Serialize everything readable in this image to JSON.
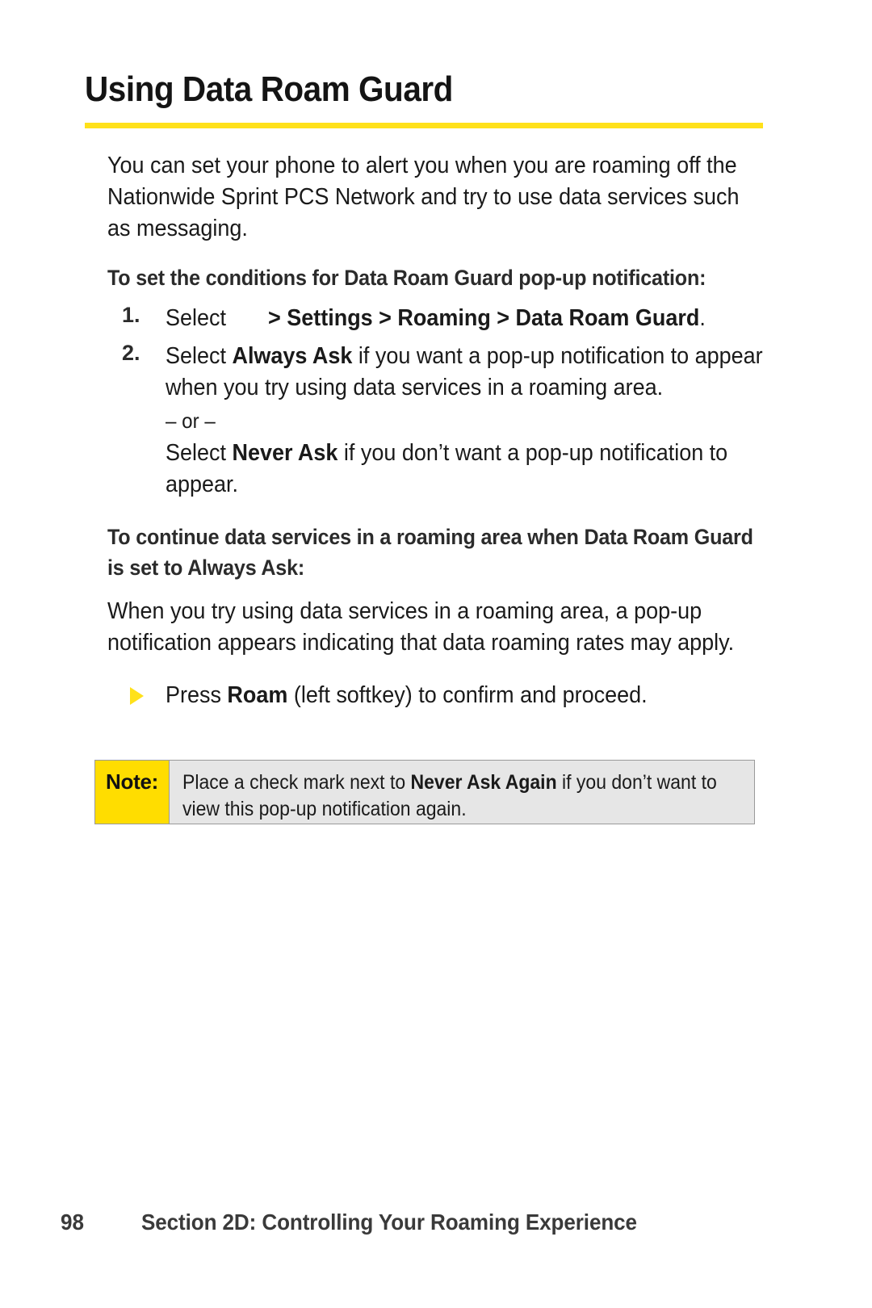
{
  "document": {
    "title": "Using Data Roam Guard",
    "accent_color": "#FFE11A",
    "note_label_color": "#FFDD00",
    "note_body_color": "#E6E6E6"
  },
  "intro": {
    "paragraph": "You can set your phone to alert you when you are roaming off the Nationwide Sprint PCS Network and try to use data services such as messaging."
  },
  "section_one": {
    "heading": "To set the conditions for Data Roam Guard pop-up notification:",
    "steps": [
      {
        "number": "1.",
        "lead": "Select",
        "menu_path": "> Settings > Roaming > Data Roam Guard",
        "trailing": "."
      },
      {
        "number": "2.",
        "lead": "Select",
        "option_a": "Always Ask",
        "text_a": " if you want a pop-up notification to appear when you try using data services in a roaming area.",
        "separator": "– or –",
        "lead_b": "Select",
        "option_b": "Never Ask",
        "text_b": " if you don’t want a pop-up notification to appear."
      }
    ]
  },
  "section_two": {
    "heading": "To continue data services in a roaming area when Data Roam Guard is set to Always Ask:",
    "paragraph": "When you try using data services in a roaming area, a pop-up notification appears indicating that data roaming rates may apply.",
    "bullet": {
      "marker": "triangle-bullet-icon",
      "lead": "Press ",
      "key": "Roam",
      "rest": " (left softkey) to confirm and proceed."
    }
  },
  "note": {
    "label": "Note:",
    "text_before": "Place a check mark next to ",
    "emphasis": "Never Ask Again",
    "text_after": " if you don’t want to view this pop-up notification again."
  },
  "footer": {
    "page_number": "98",
    "section_label": "Section 2D: Controlling Your Roaming Experience"
  }
}
